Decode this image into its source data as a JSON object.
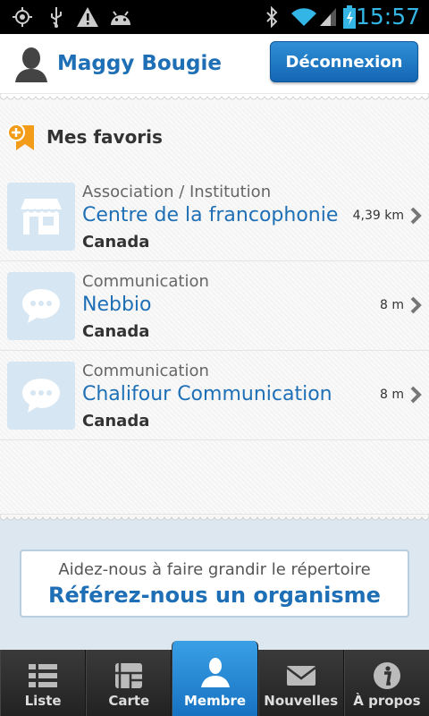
{
  "status_bar": {
    "time": "15:57",
    "icons": [
      "gps-icon",
      "usb-icon",
      "warning-icon",
      "android-icon",
      "bluetooth-icon",
      "wifi-icon",
      "signal-icon",
      "battery-icon"
    ]
  },
  "header": {
    "username": "Maggy Bougie",
    "logout_label": "Déconnexion"
  },
  "favorites": {
    "title": "Mes favoris",
    "items": [
      {
        "category": "Association / Institution",
        "name": "Centre de la francophonie",
        "country": "Canada",
        "distance": "4,39 km",
        "icon": "store-icon"
      },
      {
        "category": "Communication",
        "name": "Nebbio",
        "country": "Canada",
        "distance": "8 m",
        "icon": "chat-bubble-icon"
      },
      {
        "category": "Communication",
        "name": "Chalifour Communication",
        "country": "Canada",
        "distance": "8 m",
        "icon": "chat-bubble-icon"
      }
    ]
  },
  "banner": {
    "subtitle": "Aidez-nous à faire grandir le répertoire",
    "cta": "Référez-nous un organisme"
  },
  "tabs": [
    {
      "label": "Liste",
      "icon": "list-icon",
      "active": false
    },
    {
      "label": "Carte",
      "icon": "map-icon",
      "active": false
    },
    {
      "label": "Membre",
      "icon": "member-icon",
      "active": true
    },
    {
      "label": "Nouvelles",
      "icon": "mail-icon",
      "active": false
    },
    {
      "label": "À propos",
      "icon": "info-icon",
      "active": false
    }
  ],
  "colors": {
    "accent": "#1e6fb5",
    "tab_active": "#2a8ad6",
    "banner_bg": "#dce7f0",
    "thumb_bg": "#d6e6f2",
    "fav_icon": "#f39c1a"
  }
}
